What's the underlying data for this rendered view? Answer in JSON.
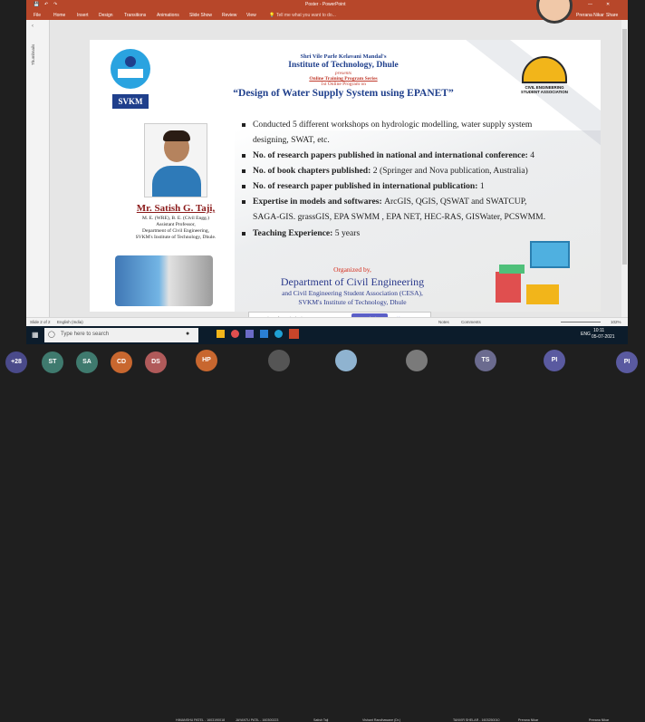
{
  "app": {
    "doc_title": "Poster - PowerPoint",
    "search_placeholder": "Tell me what you want to do...",
    "user": "Prerana Nikar",
    "share": "Share"
  },
  "ribbon_tabs": [
    "File",
    "Home",
    "Insert",
    "Design",
    "Transitions",
    "Animations",
    "Slide Show",
    "Review",
    "View"
  ],
  "thumbnails_label": "Thumbnails",
  "slide": {
    "org": "Shri Vile Parle Kelavani Mandal's",
    "institute": "Institute of Technology, Dhule",
    "presents": "presents",
    "series": "Online Training Program Series",
    "program_line": "1st Online Program on",
    "title": "“Design of Water Supply System using EPANET”",
    "logo_left": "SVKM",
    "logo_right": "CIVIL ENGINEERING STUDENT ASSOCIATION",
    "speaker": {
      "name": "Mr. Satish G. Taji,",
      "degree": "M. E. (WRE), B. E. (Civil Engg.)",
      "designation": "Assistant Professor,",
      "dept": "Department of Civil Engineering,",
      "inst": "SVKM's Institute of Technology, Dhule."
    },
    "bullets": [
      [
        {
          "t": "Conducted 5 different workshops on hydrologic modelling, water supply system",
          "b": false
        }
      ],
      [
        {
          "t": "designing, SWAT, etc.",
          "b": false
        }
      ],
      [
        {
          "t": "No. of research papers published in national and international conference: ",
          "b": true
        },
        {
          "t": "4",
          "b": false
        }
      ],
      [
        {
          "t": "No. of book chapters published: ",
          "b": true
        },
        {
          "t": "2 (Springer and Nova publication, Australia)",
          "b": false
        }
      ],
      [
        {
          "t": "No. of research paper published in international publication: ",
          "b": true
        },
        {
          "t": "1",
          "b": false
        }
      ],
      [
        {
          "t": "Expertise in models and softwares: ",
          "b": true
        },
        {
          "t": "ArcGIS, QGIS, QSWAT and SWATCUP,",
          "b": false
        }
      ],
      [
        {
          "t": "SAGA-GIS. grassGIS, EPA SWMM , EPA NET, HEC-RAS, GISWater, PCSWMM.",
          "b": false
        }
      ],
      [
        {
          "t": "Teaching Experience: ",
          "b": true
        },
        {
          "t": "5 years",
          "b": false
        }
      ]
    ],
    "organized_by": "Organized by,",
    "dept_name": "Department of Civil Engineering",
    "assoc": "and  Civil Engineering Student Association (CESA),",
    "inst_footer": "SVKM's Institute of Technology, Dhule"
  },
  "statusbar": {
    "slide_count": "Slide 2 of 2",
    "language": "English (India)",
    "notes": "Notes",
    "comments": "Comments",
    "zoom": "102%"
  },
  "share_bar": {
    "message": "teams.microsoft.com is sharing your screen.",
    "stop": "Stop sharing",
    "hide": "Hide"
  },
  "taskbar": {
    "search_placeholder": "Type here to search",
    "lang": "ENG",
    "time": "10:11",
    "date": "05-07-2021"
  },
  "participants": {
    "overflow": "+28",
    "avatars": [
      {
        "initials": "ST",
        "color": "#3f7a6e"
      },
      {
        "initials": "SA",
        "color": "#3f7a6e"
      },
      {
        "initials": "CD",
        "color": "#c8672f"
      },
      {
        "initials": "DS",
        "color": "#b05a5a"
      },
      {
        "initials": "HP",
        "color": "#c8672f"
      },
      {
        "initials": "TS",
        "color": "#6b6b8f"
      },
      {
        "initials": "PI",
        "color": "#5a5aa0"
      },
      {
        "initials": "PI",
        "color": "#5a5aa0"
      }
    ],
    "names": [
      "HIMANSHU PATEL - 1603190018",
      "JAYANTU PATIL - 160300223",
      "Satish Taji",
      "Vishant Randhawane (Dr.)",
      "TANVIR SHELAR - 1603250010",
      "Prerana Nikar",
      "Prerana Nikar"
    ]
  },
  "colors": {
    "ppt_red": "#b7472a",
    "title_blue": "#1f3f8c",
    "speaker_red": "#8b1a1a",
    "dept_blue": "#2b3a8c",
    "org_red": "#d42a1a"
  }
}
